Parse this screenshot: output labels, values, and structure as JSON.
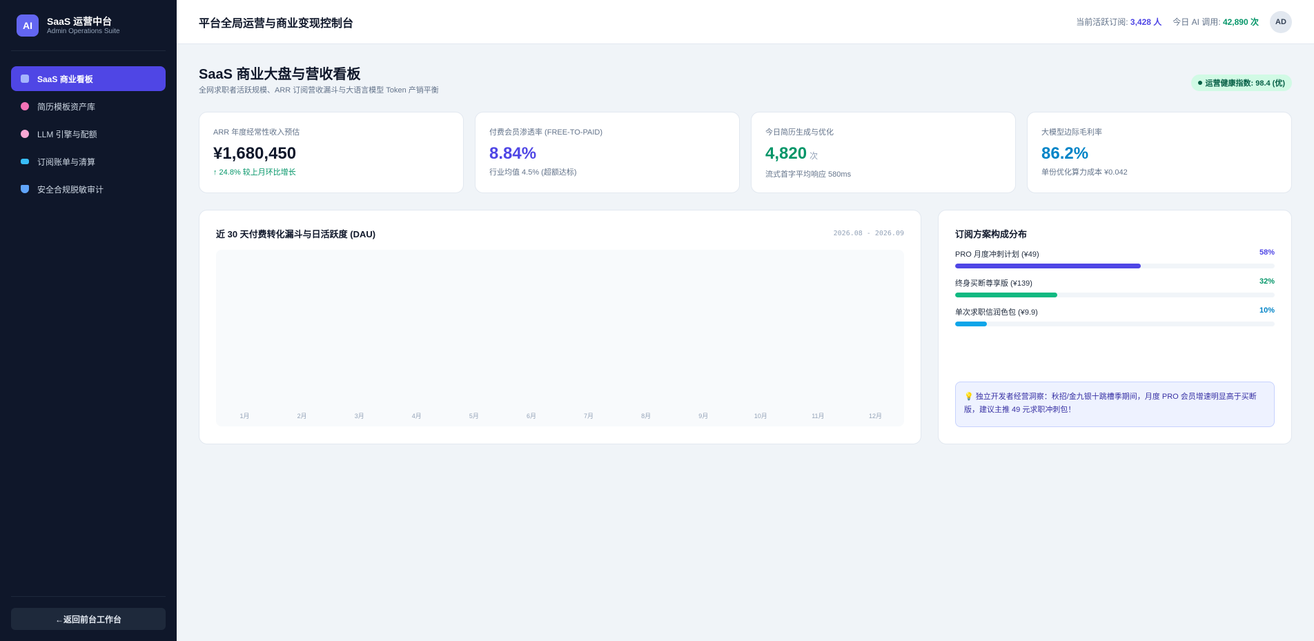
{
  "brand": {
    "logo": "AI",
    "title": "SaaS 运营中台",
    "subtitle": "Admin Operations Suite"
  },
  "sidebar": {
    "items": [
      {
        "label": "SaaS 商业看板",
        "icon": "chart-icon",
        "color": "#a5b4fc",
        "active": true
      },
      {
        "label": "简历模板资产库",
        "icon": "palette-icon",
        "color": "#f472b6"
      },
      {
        "label": "LLM 引擎与配额",
        "icon": "brain-icon",
        "color": "#f9a8d4"
      },
      {
        "label": "订阅账单与清算",
        "icon": "card-icon",
        "color": "#38bdf8"
      },
      {
        "label": "安全合规脱敏审计",
        "icon": "shield-icon",
        "color": "#60a5fa"
      }
    ],
    "back_label": "←返回前台工作台"
  },
  "topbar": {
    "title": "平台全局运营与商业变现控制台",
    "subs_label": "当前活跃订阅:",
    "subs_value": "3,428 人",
    "ai_label": "今日 AI 调用:",
    "ai_value": "42,890 次",
    "avatar": "AD"
  },
  "page": {
    "title": "SaaS 商业大盘与营收看板",
    "subtitle": "全网求职者活跃规模、ARR 订阅营收漏斗与大语言模型 Token 产销平衡",
    "health": "运营健康指数: 98.4 (优)"
  },
  "kpis": [
    {
      "label": "ARR 年度经常性收入预估",
      "value": "¥1,680,450",
      "unit": "",
      "note": "↑ 24.8% 较上月环比增长",
      "color": "#0f172a",
      "note_green": true
    },
    {
      "label": "付费会员渗透率 (FREE-TO-PAID)",
      "value": "8.84%",
      "unit": "",
      "note": "行业均值 4.5% (超额达标)",
      "color": "#4f46e5",
      "note_green": false
    },
    {
      "label": "今日简历生成与优化",
      "value": "4,820",
      "unit": "次",
      "note": "流式首字平均响应 580ms",
      "color": "#059669",
      "note_green": false
    },
    {
      "label": "大模型边际毛利率",
      "value": "86.2%",
      "unit": "",
      "note": "单份优化算力成本 ¥0.042",
      "color": "#0284c7",
      "note_green": false
    }
  ],
  "chart": {
    "title": "近 30 天付费转化漏斗与日活跃度 (DAU)",
    "range": "2026.08 - 2026.09",
    "x_labels": [
      "1月",
      "2月",
      "3月",
      "4月",
      "5月",
      "6月",
      "7月",
      "8月",
      "9月",
      "10月",
      "11月",
      "12月"
    ]
  },
  "distribution": {
    "title": "订阅方案构成分布",
    "items": [
      {
        "label": "PRO 月度冲刺计划 (¥49)",
        "pct": "58%",
        "value": 0.58,
        "color": "#4f46e5"
      },
      {
        "label": "终身买断尊享版 (¥139)",
        "pct": "32%",
        "value": 0.32,
        "color": "#10b981"
      },
      {
        "label": "单次求职信润色包 (¥9.9)",
        "pct": "10%",
        "value": 0.1,
        "color": "#0ea5e9"
      }
    ],
    "insight": "💡 独立开发者经营洞察：秋招/金九银十跳槽季期间，月度 PRO 会员增速明显高于买断版，建议主推 49 元求职冲刺包！"
  }
}
